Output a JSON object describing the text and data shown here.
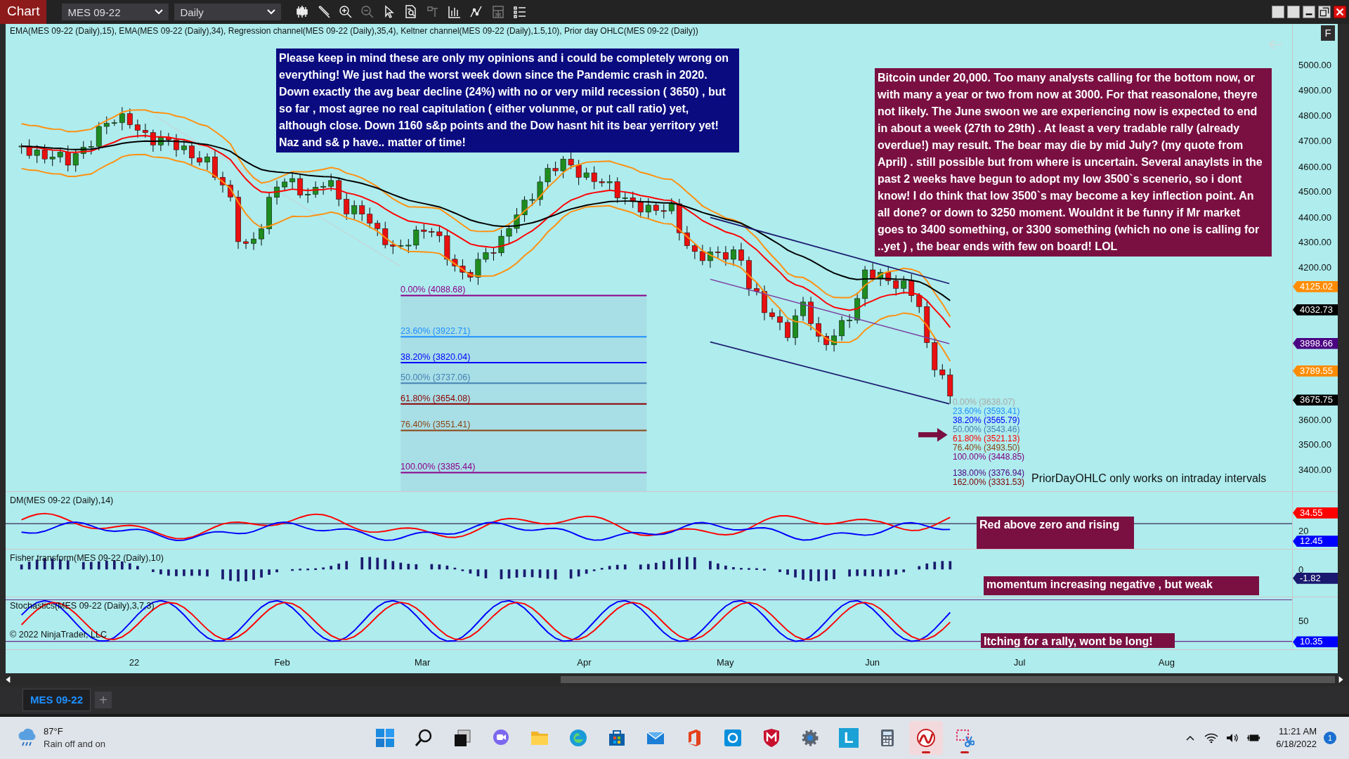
{
  "window": {
    "title": "Chart",
    "instrument": "MES 09-22",
    "interval": "Daily"
  },
  "toolbar": [
    {
      "kind": "candles",
      "disabled": false
    },
    {
      "kind": "pencil",
      "disabled": false
    },
    {
      "kind": "zoom-in",
      "disabled": false
    },
    {
      "kind": "zoom-out",
      "disabled": true
    },
    {
      "kind": "pointer",
      "disabled": false
    },
    {
      "kind": "doc-search",
      "disabled": false
    },
    {
      "kind": "bracket",
      "disabled": true
    },
    {
      "kind": "bar-chart",
      "disabled": false
    },
    {
      "kind": "line-chart",
      "disabled": false
    },
    {
      "kind": "grid",
      "disabled": true
    },
    {
      "kind": "list",
      "disabled": false
    }
  ],
  "price_panel": {
    "legend": "EMA(MES 09-22 (Daily),15), EMA(MES 09-22 (Daily),34), Regression channel(MES 09-22 (Daily),35,4), Keltner channel(MES 09-22 (Daily),1.5,10), Prior day OHLC(MES 09-22 (Daily))",
    "corner_button": "F",
    "price_ticks": [
      "5000.00",
      "4900.00",
      "4800.00",
      "4700.00",
      "4600.00",
      "4500.00",
      "4400.00",
      "4300.00",
      "4200.00",
      "3600.00",
      "3500.00",
      "3400.00"
    ],
    "price_flags": [
      {
        "value": "4125.02",
        "color": "#ff8c00"
      },
      {
        "value": "4032.73",
        "color": "#000000"
      },
      {
        "value": "3898.66",
        "color": "#4b0082"
      },
      {
        "value": "3789.55",
        "color": "#ff8c00"
      },
      {
        "value": "3675.75",
        "color": "#000000"
      }
    ],
    "fib_levels": [
      {
        "label": "0.00% (4088.68)",
        "color": "#8b008b"
      },
      {
        "label": "23.60% (3922.71)",
        "color": "#1e90ff"
      },
      {
        "label": "38.20% (3820.04)",
        "color": "#0000ff"
      },
      {
        "label": "50.00% (3737.06)",
        "color": "#4682b4"
      },
      {
        "label": "61.80% (3654.08)",
        "color": "#8b0000"
      },
      {
        "label": "76.40% (3551.41)",
        "color": "#8b4513"
      },
      {
        "label": "100.00% (3385.44)",
        "color": "#8b008b"
      }
    ],
    "fib_extension": [
      {
        "label": "0.00% (3638.07)",
        "color": "#a9a9a9"
      },
      {
        "label": "23.60% (3593.41)",
        "color": "#1e90ff"
      },
      {
        "label": "38.20% (3565.79)",
        "color": "#0000ff"
      },
      {
        "label": "50.00% (3543.46)",
        "color": "#4682b4"
      },
      {
        "label": "61.80% (3521.13)",
        "color": "#ff0000"
      },
      {
        "label": "76.40% (3493.50)",
        "color": "#8b4513"
      },
      {
        "label": "100.00% (3448.85)",
        "color": "#800080"
      },
      {
        "label": "138.00% (3376.94)",
        "color": "#4b0082"
      },
      {
        "label": "162.00% (3331.53)",
        "color": "#800000"
      }
    ],
    "notice": "PriorDayOHLC only works on intraday intervals",
    "notes": [
      {
        "text": "Please keep in mind these are only my opinions and i could be completely wrong on everything! We just had the worst week down since the Pandemic crash in 2020. Down exactly the avg bear decline (24%) with no or very mild recession ( 3650) , but so far , most agree no real capitulation ( either volunme, or put call ratio) yet, although close. Down 1160 s&p points and the Dow hasnt hit its bear yerritory yet! Naz  and s& p have.. matter of time!",
        "color": "#0b0b80"
      },
      {
        "text": "Bitcoin under 20,000. Too many analysts calling for the bottom now, or with many a year or two from now at 3000. For that reasonalone, theyre not likely. The June swoon we are experiencing now is expected to end in about a week (27th to 29th) . At least a very tradable rally (already overdue!) may result. The bear may die by mid July? (my quote from April) . still possible but from where is uncertain. Several anaylsts in the past 2 weeks have begun to adopt my low 3500`s scenerio, so i dont know! I do think that low 3500`s may become a key inflection point. An all done? or down to 3250 moment. Wouldnt it be funny if Mr market goes to 3400 something, or 3300 something  (which no one is calling for ..yet ) , the bear ends with few on board! LOL",
        "color": "#7a1042"
      }
    ]
  },
  "dm_panel": {
    "label": "DM(MES 09-22 (Daily),14)",
    "ticks": [
      "20"
    ],
    "flags": [
      {
        "value": "34.55",
        "color": "#ff0000"
      },
      {
        "value": "12.45",
        "color": "#0000ff"
      }
    ],
    "note": "Red above zero and rising"
  },
  "fisher_panel": {
    "label": "Fisher transform(MES 09-22 (Daily),10)",
    "ticks": [
      "0"
    ],
    "flags": [
      {
        "value": "-1.82",
        "color": "#191970"
      }
    ],
    "note": "momentum increasing negative , but weak"
  },
  "stoch_panel": {
    "label": "Stochastics(MES 09-22 (Daily),3,7,3)",
    "copyright": "© 2022 NinjaTrader, LLC",
    "ticks": [
      "50"
    ],
    "flags": [
      {
        "value": "10.35",
        "color": "#0000ff"
      }
    ],
    "note": "Itching for a rally, wont be long!"
  },
  "x_axis": [
    "22",
    "Feb",
    "Mar",
    "Apr",
    "May",
    "Jun",
    "Jul",
    "Aug"
  ],
  "tabs": [
    {
      "label": "MES 09-22",
      "selected": true
    }
  ],
  "add_tab": "+",
  "taskbar": {
    "temperature": "87°F",
    "weather": "Rain off and on",
    "apps": [
      {
        "kind": "start",
        "running": false,
        "selected": false
      },
      {
        "kind": "search",
        "running": false,
        "selected": false
      },
      {
        "kind": "task-view",
        "running": false,
        "selected": false
      },
      {
        "kind": "chat",
        "running": false,
        "selected": false
      },
      {
        "kind": "folder",
        "running": false,
        "selected": false
      },
      {
        "kind": "browser",
        "running": false,
        "selected": false
      },
      {
        "kind": "store",
        "running": false,
        "selected": false
      },
      {
        "kind": "mail",
        "running": false,
        "selected": false
      },
      {
        "kind": "office",
        "running": false,
        "selected": false
      },
      {
        "kind": "ring",
        "running": false,
        "selected": false
      },
      {
        "kind": "shield",
        "running": false,
        "selected": false
      },
      {
        "kind": "gear",
        "running": false,
        "selected": false
      },
      {
        "kind": "letter",
        "text": "L",
        "running": false,
        "selected": false
      },
      {
        "kind": "calculator",
        "running": false,
        "selected": false
      },
      {
        "kind": "swoosh",
        "running": true,
        "selected": true
      },
      {
        "kind": "snip",
        "running": true,
        "selected": false
      }
    ],
    "time": "11:21 AM",
    "date": "6/18/2022",
    "notifications": "1"
  }
}
